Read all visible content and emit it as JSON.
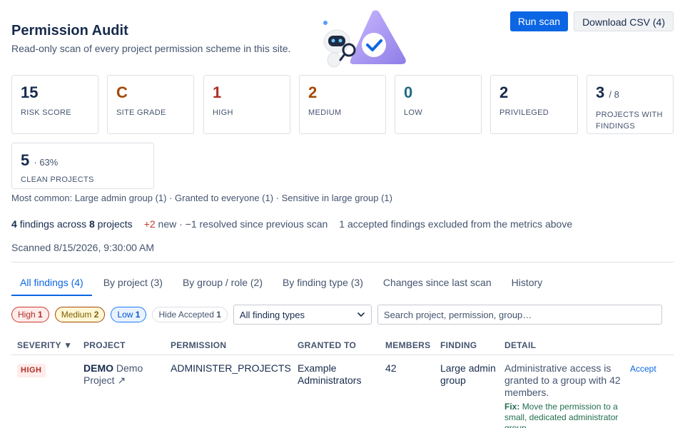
{
  "header": {
    "title": "Permission Audit",
    "subtitle": "Read-only scan of every project permission scheme in this site."
  },
  "actions": {
    "run_scan": "Run scan",
    "download_csv": "Download CSV (4)"
  },
  "metrics": [
    {
      "value": "15",
      "suffix": "",
      "label": "RISK SCORE",
      "color": "#172b4d"
    },
    {
      "value": "C",
      "suffix": "",
      "label": "SITE GRADE",
      "color": "#a54800"
    },
    {
      "value": "1",
      "suffix": "",
      "label": "HIGH",
      "color": "#ae2e24"
    },
    {
      "value": "2",
      "suffix": "",
      "label": "MEDIUM",
      "color": "#a54800"
    },
    {
      "value": "0",
      "suffix": "",
      "label": "LOW",
      "color": "#206a83"
    },
    {
      "value": "2",
      "suffix": "",
      "label": "PRIVILEGED",
      "color": "#172b4d"
    },
    {
      "value": "3",
      "suffix": "/ 8",
      "label": "PROJECTS WITH FINDINGS",
      "color": "#172b4d"
    },
    {
      "value": "5",
      "suffix": "· 63%",
      "label": "CLEAN PROJECTS",
      "color": "#172b4d"
    }
  ],
  "most_common": "Most common: Large admin group (1) · Granted to everyone (1) · Sensitive in large group (1)",
  "summary": {
    "findings_count": "4",
    "findings_text": "findings across",
    "projects_count": "8",
    "projects_text": "projects",
    "new_delta": "+2",
    "new_text": "new ·",
    "resolved_text": "−1 resolved since previous scan",
    "accepted_text": "1 accepted findings excluded from the metrics above"
  },
  "scanned": "Scanned 8/15/2026, 9:30:00 AM",
  "tabs": [
    {
      "label": "All findings (4)",
      "active": true
    },
    {
      "label": "By project (3)",
      "active": false
    },
    {
      "label": "By group / role (2)",
      "active": false
    },
    {
      "label": "By finding type (3)",
      "active": false
    },
    {
      "label": "Changes since last scan",
      "active": false
    },
    {
      "label": "History",
      "active": false
    }
  ],
  "filters": {
    "high_label": "High",
    "high_count": "1",
    "medium_label": "Medium",
    "medium_count": "2",
    "low_label": "Low",
    "low_count": "1",
    "accepted_label": "Hide Accepted",
    "accepted_count": "1",
    "type_select": "All finding types",
    "search_placeholder": "Search project, permission, group…"
  },
  "table": {
    "headers": {
      "severity": "SEVERITY ▼",
      "project": "PROJECT",
      "permission": "PERMISSION",
      "granted_to": "GRANTED TO",
      "members": "MEMBERS",
      "finding": "FINDING",
      "detail": "DETAIL"
    },
    "rows": [
      {
        "severity": "HIGH",
        "project_key": "DEMO",
        "project_name": "Demo Project ↗",
        "permission": "ADMINISTER_PROJECTS",
        "granted_to": "Example Administrators",
        "members": "42",
        "finding": "Large admin group",
        "detail": "Administrative access is granted to a group with 42 members.",
        "fix_label": "Fix:",
        "fix_text": "Move the permission to a small, dedicated administrator group.",
        "action": "Accept"
      }
    ]
  },
  "colors": {
    "primary": "#0c66e4",
    "high": "#ae2e24",
    "medium": "#a54800",
    "low": "#206a83",
    "fix": "#216e4e"
  },
  "icons": {
    "illustration": "robot-with-magnifier-and-check-triangle",
    "select_chevron": "chevron-down-icon",
    "external_link": "external-link-icon"
  }
}
